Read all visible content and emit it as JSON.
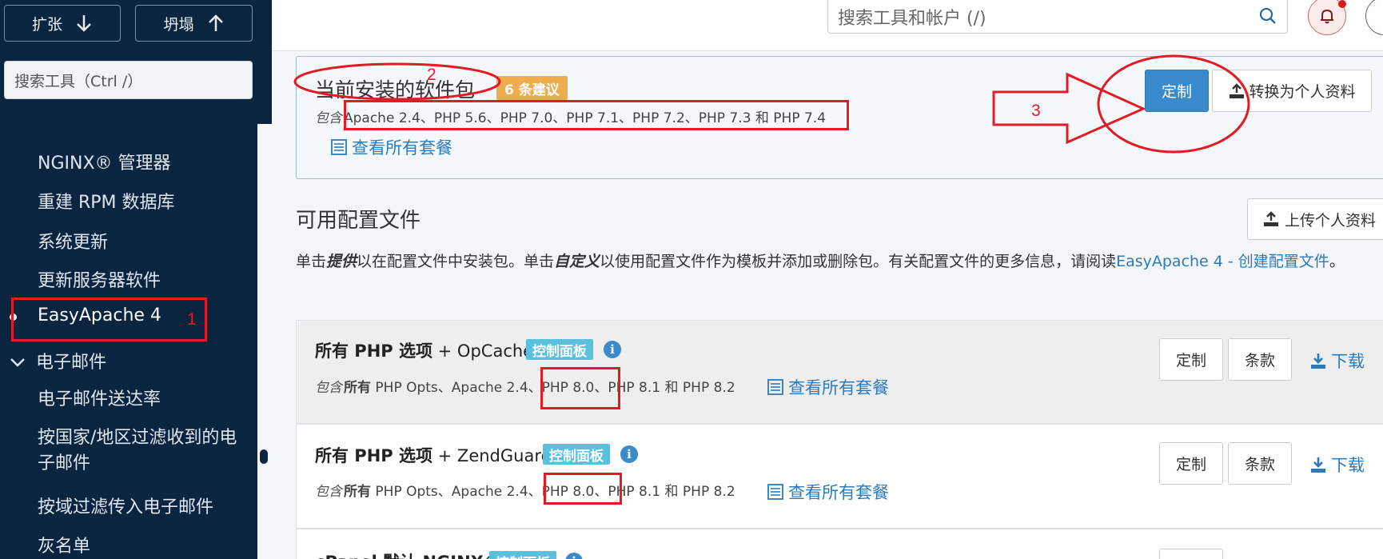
{
  "sidebar": {
    "expand_label": "扩张",
    "collapse_label": "坍塌",
    "search_placeholder": "搜索工具（Ctrl /）",
    "items": [
      "NGINX® 管理器",
      "重建 RPM 数据库",
      "系统更新",
      "更新服务器软件",
      "EasyApache 4",
      "电子邮件",
      "电子邮件送达率",
      "按国家/地区过滤收到的电子邮件",
      "按域过滤传入电子邮件",
      "灰名单"
    ]
  },
  "topbar": {
    "search_placeholder": "搜索工具和帐户 (/)"
  },
  "current": {
    "title": "当前安装的软件包",
    "suggestions_badge": "6 条建议",
    "includes_label": "包含",
    "packages": "Apache 2.4、PHP 5.6、PHP 7.0、PHP 7.1、PHP 7.2、PHP 7.3 和 PHP 7.4",
    "view_all": "查看所有套餐",
    "customize_label": "定制",
    "convert_label": "转换为个人资料"
  },
  "profiles": {
    "title": "可用配置文件",
    "upload_label": "上传个人资料",
    "desc_1": "单击",
    "desc_provide": "提供",
    "desc_2": "以在配置文件中安装包。单击",
    "desc_customize": "自定义",
    "desc_3": "以使用配置文件作为模板并添加或删除包。有关配置文件的更多信息，请阅读",
    "desc_link": "EasyApache 4 - 创建配置文件",
    "desc_end": "。",
    "rows": [
      {
        "title_lead": "所有 PHP 选项",
        "title_rest": " + OpCache",
        "badge": "控制面板",
        "includes_label": "包含",
        "packages_lead": "所有",
        "packages": " PHP Opts、Apache 2.4、PHP 8.0、PHP 8.1 和 PHP 8.2",
        "view_all": "查看所有套餐",
        "customize_label": "定制",
        "terms_label": "条款",
        "download_label": "下载"
      },
      {
        "title_lead": "所有 PHP 选项",
        "title_rest": " + ZendGuard",
        "badge": "控制面板",
        "includes_label": "包含",
        "packages_lead": "所有",
        "packages": " PHP Opts、Apache 2.4、PHP 8.0、PHP 8.1 和 PHP 8.2",
        "view_all": "查看所有套餐",
        "customize_label": "定制",
        "terms_label": "条款",
        "download_label": "下载"
      },
      {
        "title_lead": "cPanel 默认 NGINX®",
        "title_rest": "",
        "badge": "控制面板"
      }
    ]
  },
  "annotations": {
    "n1": "1",
    "n2": "2",
    "n3": "3"
  },
  "colors": {
    "sidebar_bg": "#0b2540",
    "primary": "#3a8bcd",
    "badge_orange": "#f0ad4e",
    "badge_blue": "#5bc0de",
    "annotation_red": "#e31b23"
  }
}
